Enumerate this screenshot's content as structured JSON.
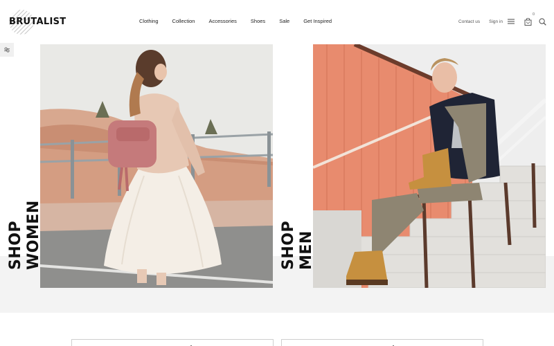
{
  "brand": {
    "name": "BRUTALIST"
  },
  "nav": {
    "items": [
      {
        "label": "Clothing"
      },
      {
        "label": "Collection"
      },
      {
        "label": "Accessories"
      },
      {
        "label": "Shoes"
      },
      {
        "label": "Sale"
      },
      {
        "label": "Get Inspired"
      }
    ]
  },
  "header_right": {
    "contact_label": "Contact us",
    "signin_label": "Sign in",
    "cart_count": "0"
  },
  "hero": {
    "women": {
      "line1": "SHOP",
      "line2": "WOMEN"
    },
    "men": {
      "line1": "SHOP",
      "line2": "MEN"
    }
  },
  "colors": {
    "text": "#111111",
    "band": "#f3f3f3",
    "wall": "#e88b6e",
    "sky": "#e9e9e6"
  }
}
